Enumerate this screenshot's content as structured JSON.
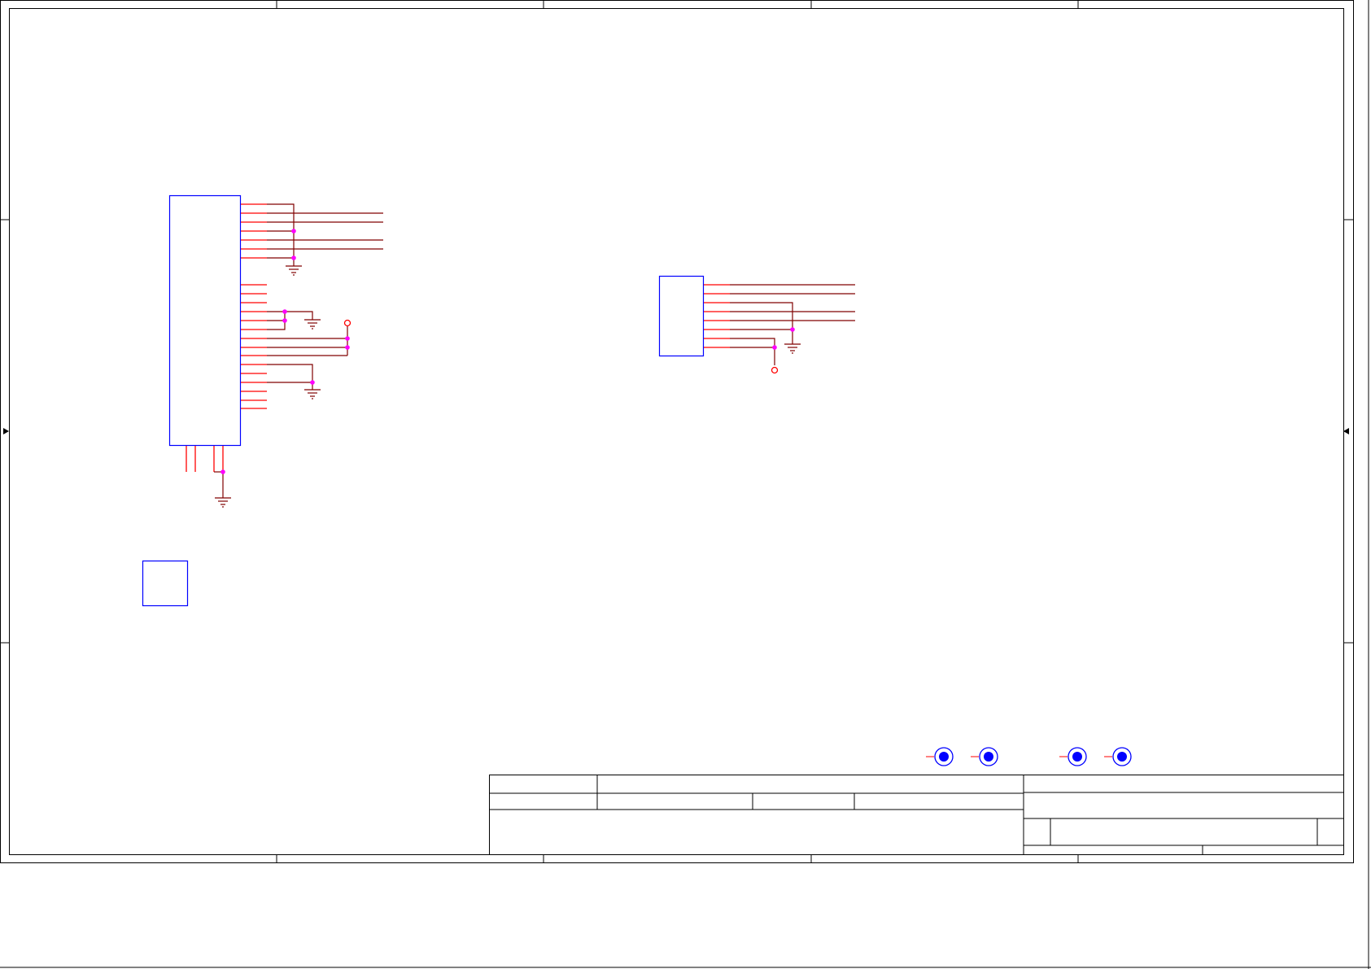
{
  "colors": {
    "frame": "#000000",
    "component_outline": "#0000ff",
    "pin": "#ff0000",
    "wire": "#800000",
    "junction": "#ff00ff",
    "ground": "#800000",
    "power_port": "#ff0000",
    "mounting_hole": "#0000ff"
  },
  "components": [
    {
      "kind": "connector-header",
      "pin_count": 26
    },
    {
      "kind": "connector-header",
      "pin_count": 8
    },
    {
      "kind": "blank-part"
    }
  ],
  "ground_symbols": 5,
  "power_ports": 2,
  "mounting_holes": 4,
  "title_block": {
    "visible_text": []
  }
}
